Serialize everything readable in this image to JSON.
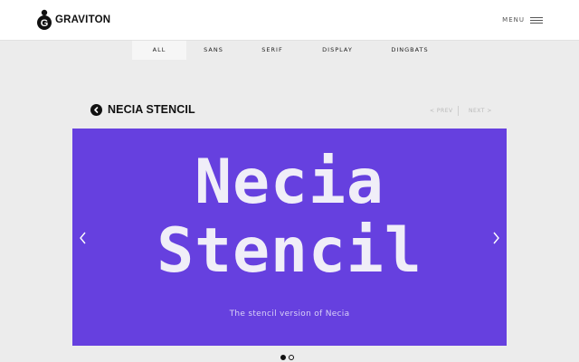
{
  "header": {
    "logo_text": "GRAVITON",
    "logo_mark_letter": "G",
    "menu_label": "MENU"
  },
  "tabs": [
    {
      "label": "ALL",
      "active": true
    },
    {
      "label": "SANS",
      "active": false
    },
    {
      "label": "SERIF",
      "active": false
    },
    {
      "label": "DISPLAY",
      "active": false
    },
    {
      "label": "DINGBATS",
      "active": false
    }
  ],
  "font_page": {
    "title": "NECIA STENCIL",
    "prev_label": "< PREV",
    "next_label": "NEXT >"
  },
  "slider": {
    "heading_line1": "Necia",
    "heading_line2": "Stencil",
    "caption": "The stencil version of Necia",
    "background_color": "#6640df",
    "total_slides": 2,
    "active_slide": 1
  },
  "icons": {
    "logo": "graviton-logo-icon",
    "menu": "hamburger-icon",
    "back": "back-arrow-icon",
    "slider_prev": "chevron-left-icon",
    "slider_next": "chevron-right-icon"
  }
}
